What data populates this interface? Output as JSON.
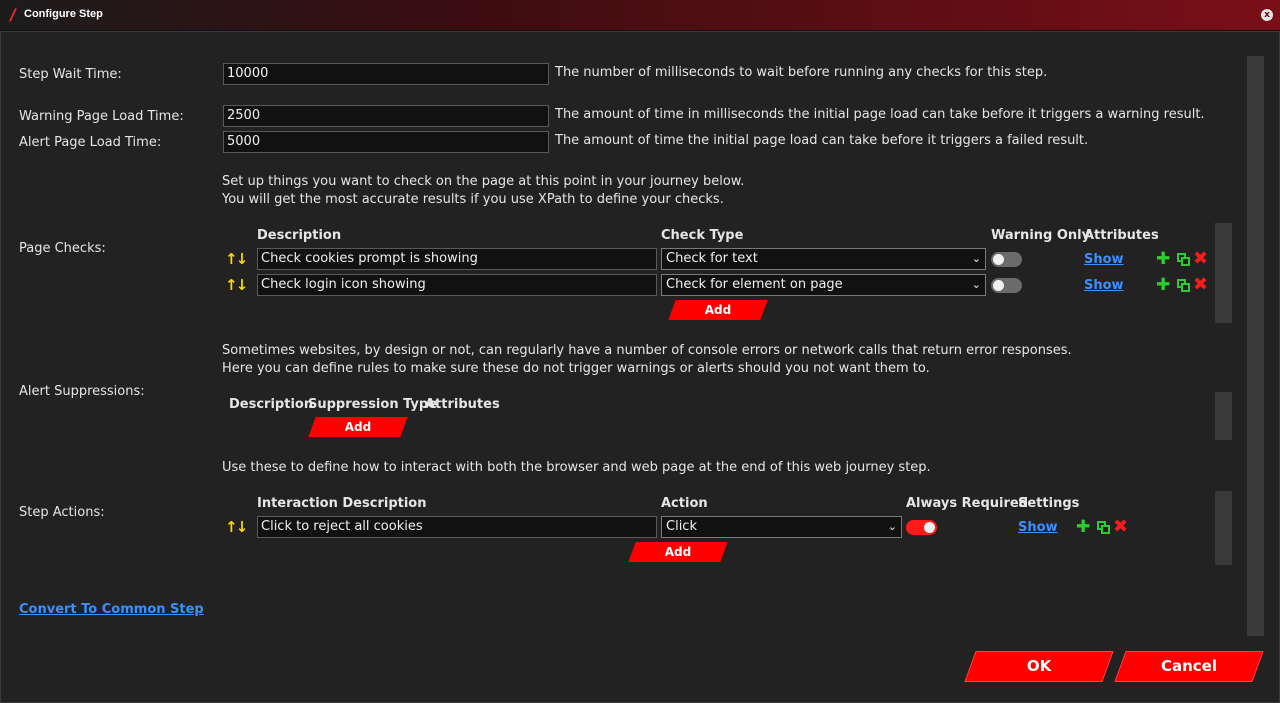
{
  "window": {
    "title": "Configure Step",
    "close_glyph": "x"
  },
  "fields": {
    "step_wait": {
      "label": "Step Wait Time:",
      "value": "10000",
      "help": "The number of milliseconds to wait before running any checks for this step."
    },
    "warning_load": {
      "label": "Warning Page Load Time:",
      "value": "2500",
      "help": "The amount of time in milliseconds the initial page load can take before it triggers a warning result."
    },
    "alert_load": {
      "label": "Alert Page Load Time:",
      "value": "5000",
      "help": "The amount of time the initial page load can take before it triggers a failed result."
    }
  },
  "page_checks": {
    "intro_line1": "Set up things you want to check on the page at this point in your journey below.",
    "intro_line2": "You will get the most accurate results if you use XPath to define your checks.",
    "label": "Page Checks:",
    "headers": {
      "description": "Description",
      "check_type": "Check Type",
      "warning_only": "Warning Only",
      "attributes": "Attributes"
    },
    "rows": [
      {
        "description": "Check cookies prompt is showing",
        "check_type": "Check for text",
        "warning_only": false,
        "attributes_link": "Show"
      },
      {
        "description": "Check login icon showing",
        "check_type": "Check for element on page",
        "warning_only": false,
        "attributes_link": "Show"
      }
    ],
    "add_label": "Add"
  },
  "alert_suppressions": {
    "intro_line1": "Sometimes websites, by design or not, can regularly have a number of console errors or network calls that return error responses.",
    "intro_line2": "Here you can define rules to make sure these do not trigger warnings or alerts should you not want them to.",
    "label": "Alert Suppressions:",
    "headers": {
      "description": "Description",
      "suppression_type": "Suppression Type",
      "attributes": "Attributes"
    },
    "add_label": "Add"
  },
  "step_actions": {
    "intro": "Use these to define how to interact with both the browser and web page at the end of this web journey step.",
    "label": "Step Actions:",
    "headers": {
      "interaction_description": "Interaction Description",
      "action": "Action",
      "always_required": "Always Required",
      "settings": "Settings"
    },
    "rows": [
      {
        "description": "Click to reject all cookies",
        "action": "Click",
        "always_required": true,
        "settings_link": "Show"
      }
    ],
    "add_label": "Add"
  },
  "convert_link": "Convert To Common Step",
  "buttons": {
    "ok": "OK",
    "cancel": "Cancel"
  },
  "icons": {
    "move": "up-down-arrows-icon",
    "add": "plus-icon",
    "copy": "copy-icon",
    "delete": "close-icon"
  },
  "colors": {
    "accent": "#ff0000",
    "link": "#3d8fff",
    "arrows": "#ffd400",
    "add_icon": "#2ecc2e",
    "background": "#222222"
  }
}
